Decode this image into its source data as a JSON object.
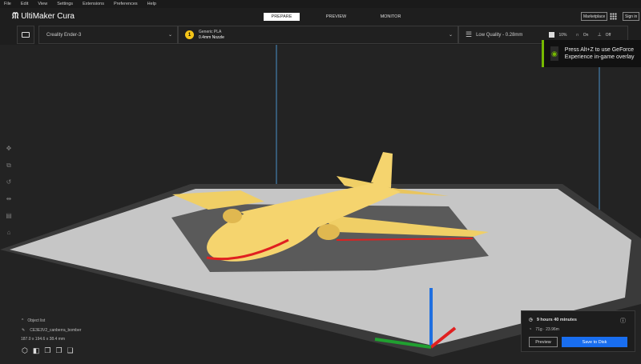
{
  "menu": [
    "File",
    "Edit",
    "View",
    "Settings",
    "Extensions",
    "Preferences",
    "Help"
  ],
  "app_title": "UltiMaker Cura",
  "stages": [
    "PREPARE",
    "PREVIEW",
    "MONITOR"
  ],
  "header_buttons": {
    "marketplace": "Marketplace",
    "sign_in": "Sign in"
  },
  "printer": "Creality Ender-3",
  "material": {
    "badge": "1",
    "name": "Generic PLA",
    "nozzle": "0.4mm Nozzle"
  },
  "print_settings": {
    "profile": "Low Quality - 0.28mm",
    "infill": "10%",
    "support": "On",
    "adhesion": "Off"
  },
  "toast": {
    "text": "Press Alt+Z to use GeForce Experience in-game overlay"
  },
  "object_list": {
    "label": "Object list",
    "object_name": "CE3E3V2_canberra_bomber",
    "dimensions": "187.0 x 194.6 x 38.4 mm"
  },
  "print_info": {
    "time": "9 hours 40 minutes",
    "material": "71g · 23.96m",
    "preview": "Preview",
    "save": "Save to Disk"
  },
  "colors": {
    "accent": "#196ef0",
    "model": "#f5d46e",
    "plate": "#c8c8c8",
    "nvidia": "#76b900"
  }
}
